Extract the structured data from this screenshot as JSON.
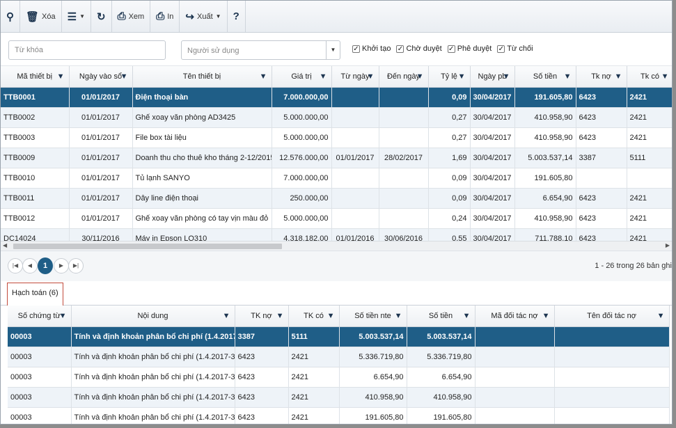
{
  "toolbar": {
    "buttons": [
      {
        "icon": "binoculars-icon",
        "glyph": "⚲",
        "label": ""
      },
      {
        "icon": "trash-icon",
        "glyph": "🗑",
        "label": "Xóa"
      },
      {
        "icon": "menu-icon",
        "glyph": "☰",
        "label": "",
        "caret": "▼"
      },
      {
        "icon": "refresh-icon",
        "glyph": "↻",
        "label": ""
      },
      {
        "icon": "print-preview-icon",
        "glyph": "⎙",
        "label": "Xem"
      },
      {
        "icon": "print-icon",
        "glyph": "⎙",
        "label": "In"
      },
      {
        "icon": "export-icon",
        "glyph": "↪",
        "label": "Xuất",
        "caret": "▼"
      },
      {
        "icon": "help-icon",
        "glyph": "?",
        "label": ""
      }
    ]
  },
  "filters": {
    "keyword_placeholder": "Từ khóa",
    "user_placeholder": "Người sử dụng",
    "checkboxes": [
      {
        "label": "Khởi tạo",
        "checked": true
      },
      {
        "label": "Chờ duyệt",
        "checked": true
      },
      {
        "label": "Phê duyệt",
        "checked": true
      },
      {
        "label": "Từ chối",
        "checked": true
      }
    ]
  },
  "main_grid": {
    "columns": [
      "Mã thiết bị",
      "Ngày vào sổ",
      "Tên thiết bị",
      "Giá trị",
      "Từ ngày",
      "Đến ngày",
      "Tỷ lệ",
      "Ngày pb",
      "Số tiền",
      "Tk nợ",
      "Tk có"
    ],
    "rows": [
      [
        "TTB0001",
        "01/01/2017",
        "Điện thoại bàn",
        "7.000.000,00",
        "",
        "",
        "0,09",
        "30/04/2017",
        "191.605,80",
        "6423",
        "2421"
      ],
      [
        "TTB0002",
        "01/01/2017",
        "Ghế xoay văn phòng AD3425",
        "5.000.000,00",
        "",
        "",
        "0,27",
        "30/04/2017",
        "410.958,90",
        "6423",
        "2421"
      ],
      [
        "TTB0003",
        "01/01/2017",
        "File box tài liệu",
        "5.000.000,00",
        "",
        "",
        "0,27",
        "30/04/2017",
        "410.958,90",
        "6423",
        "2421"
      ],
      [
        "TTB0009",
        "01/01/2017",
        "Doanh thu cho thuê kho tháng 2-12/2015",
        "12.576.000,00",
        "01/01/2017",
        "28/02/2017",
        "1,69",
        "30/04/2017",
        "5.003.537,14",
        "3387",
        "5111"
      ],
      [
        "TTB0010",
        "01/01/2017",
        "Tủ lạnh SANYO",
        "7.000.000,00",
        "",
        "",
        "0,09",
        "30/04/2017",
        "191.605,80",
        "",
        ""
      ],
      [
        "TTB0011",
        "01/01/2017",
        "Dây line điện thoại",
        "250.000,00",
        "",
        "",
        "0,09",
        "30/04/2017",
        "6.654,90",
        "6423",
        "2421"
      ],
      [
        "TTB0012",
        "01/01/2017",
        "Ghế xoay văn phòng có tay vịn màu đỏ",
        "5.000.000,00",
        "",
        "",
        "0,24",
        "30/04/2017",
        "410.958,90",
        "6423",
        "2421"
      ],
      [
        "DC14024",
        "30/11/2016",
        "Máy in Epson LQ310",
        "4.318.182,00",
        "01/01/2016",
        "30/06/2016",
        "0,55",
        "30/04/2017",
        "711.788,10",
        "6423",
        "2421"
      ]
    ],
    "selected_row": 0
  },
  "pager": {
    "first": "|◀",
    "prev": "◀",
    "current_page": "1",
    "next": "▶",
    "last": "▶|",
    "info": "1 - 26 trong 26 bản ghi"
  },
  "detail_tab": {
    "label": "Hạch toán (6)"
  },
  "detail_grid": {
    "columns": [
      "Số chứng từ",
      "Nội dung",
      "TK nợ",
      "TK có",
      "Số tiền nte",
      "Số tiền",
      "Mã đối tác nợ",
      "Tên đối tác nợ"
    ],
    "rows": [
      [
        "00003",
        "Tính và định khoản phân bổ chi phí (1.4.2017-30.4.2017)",
        "3387",
        "5111",
        "5.003.537,14",
        "5.003.537,14",
        "",
        ""
      ],
      [
        "00003",
        "Tính và định khoản phân bổ chi phí (1.4.2017-30.4.2017)",
        "6423",
        "2421",
        "5.336.719,80",
        "5.336.719,80",
        "",
        ""
      ],
      [
        "00003",
        "Tính và định khoản phân bổ chi phí (1.4.2017-30.4.2017)",
        "6423",
        "2421",
        "6.654,90",
        "6.654,90",
        "",
        ""
      ],
      [
        "00003",
        "Tính và định khoản phân bổ chi phí (1.4.2017-30.4.2017)",
        "6423",
        "2421",
        "410.958,90",
        "410.958,90",
        "",
        ""
      ],
      [
        "00003",
        "Tính và định khoản phân bổ chi phí (1.4.2017-30.4.2017)",
        "6423",
        "2421",
        "191.605,80",
        "191.605,80",
        "",
        ""
      ]
    ],
    "selected_row": 0
  },
  "colors": {
    "selected_row": "#1f5e87",
    "alt_row": "#eef3f8",
    "tab_border": "#c24a3a"
  }
}
